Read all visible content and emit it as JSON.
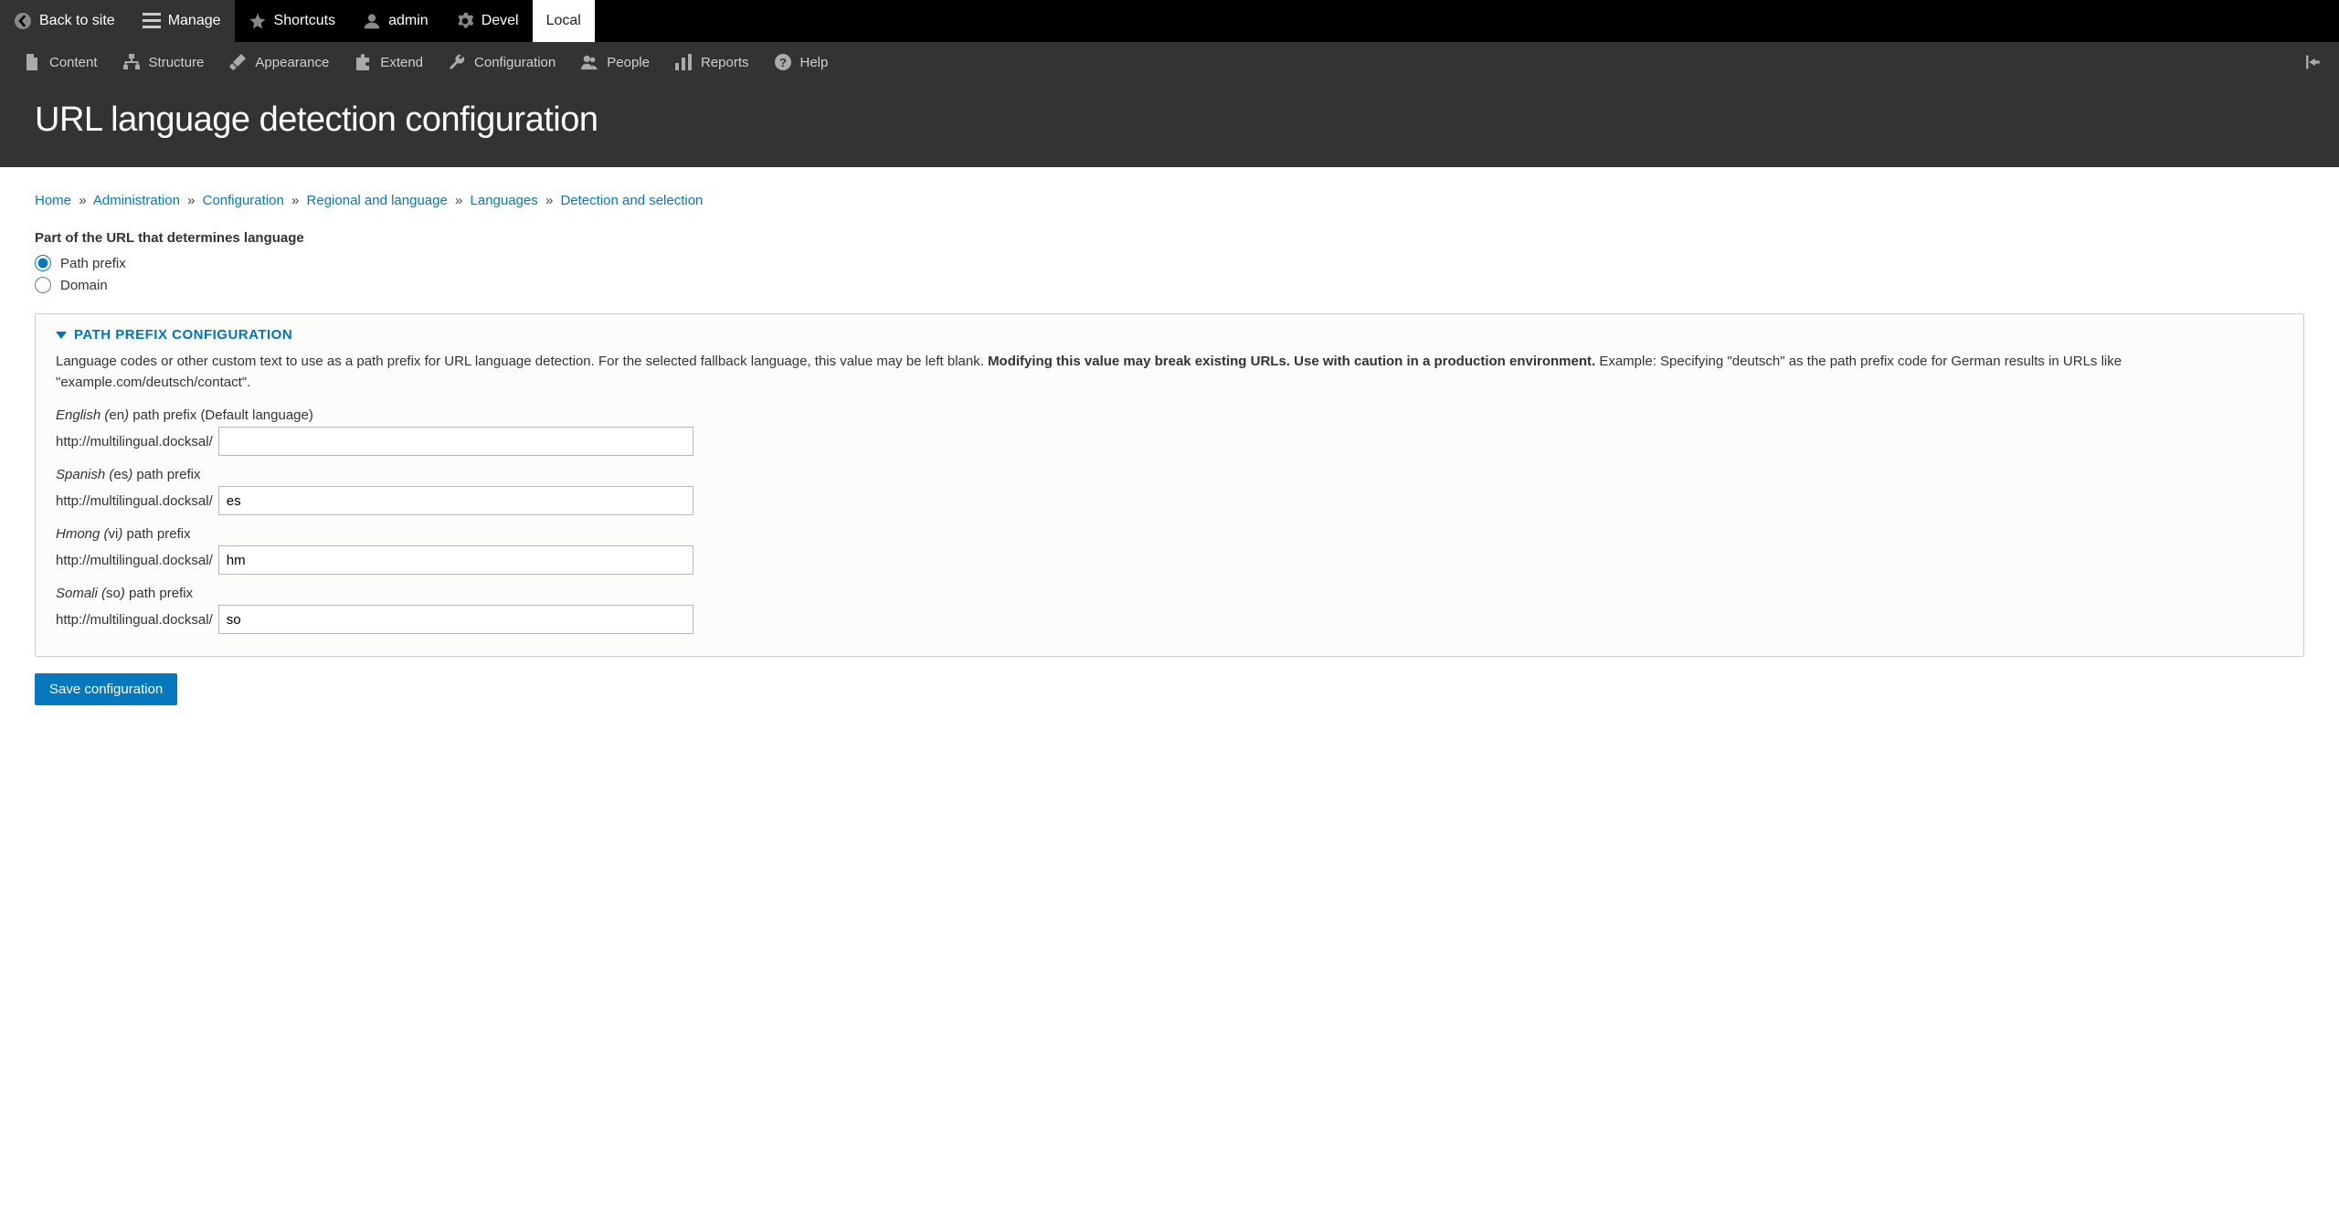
{
  "toolbar": {
    "back_to_site": "Back to site",
    "manage": "Manage",
    "shortcuts": "Shortcuts",
    "user": "admin",
    "devel": "Devel",
    "local": "Local"
  },
  "admin_menu": {
    "content": "Content",
    "structure": "Structure",
    "appearance": "Appearance",
    "extend": "Extend",
    "configuration": "Configuration",
    "people": "People",
    "reports": "Reports",
    "help": "Help"
  },
  "page_title": "URL language detection configuration",
  "breadcrumb": {
    "items": [
      {
        "label": "Home"
      },
      {
        "label": "Administration"
      },
      {
        "label": "Configuration"
      },
      {
        "label": "Regional and language"
      },
      {
        "label": "Languages"
      },
      {
        "label": "Detection and selection"
      }
    ],
    "sep": "»"
  },
  "url_part": {
    "legend": "Part of the URL that determines language",
    "options": {
      "path_prefix": "Path prefix",
      "domain": "Domain"
    },
    "selected": "path_prefix"
  },
  "prefix_config": {
    "summary": "PATH PREFIX CONFIGURATION",
    "help_plain": "Language codes or other custom text to use as a path prefix for URL language detection. For the selected fallback language, this value may be left blank. ",
    "help_strong": "Modifying this value may break existing URLs. Use with caution in a production environment.",
    "help_example": " Example: Specifying \"deutsch\" as the path prefix code for German results in URLs like \"example.com/deutsch/contact\".",
    "url_base": "http://multilingual.docksal/",
    "languages": [
      {
        "name": "English",
        "code": "en",
        "suffix": " path prefix (Default language)",
        "value": ""
      },
      {
        "name": "Spanish",
        "code": "es",
        "suffix": " path prefix",
        "value": "es"
      },
      {
        "name": "Hmong",
        "code": "vi",
        "suffix": " path prefix",
        "value": "hm"
      },
      {
        "name": "Somali",
        "code": "so",
        "suffix": " path prefix",
        "value": "so"
      }
    ]
  },
  "save_label": "Save configuration"
}
